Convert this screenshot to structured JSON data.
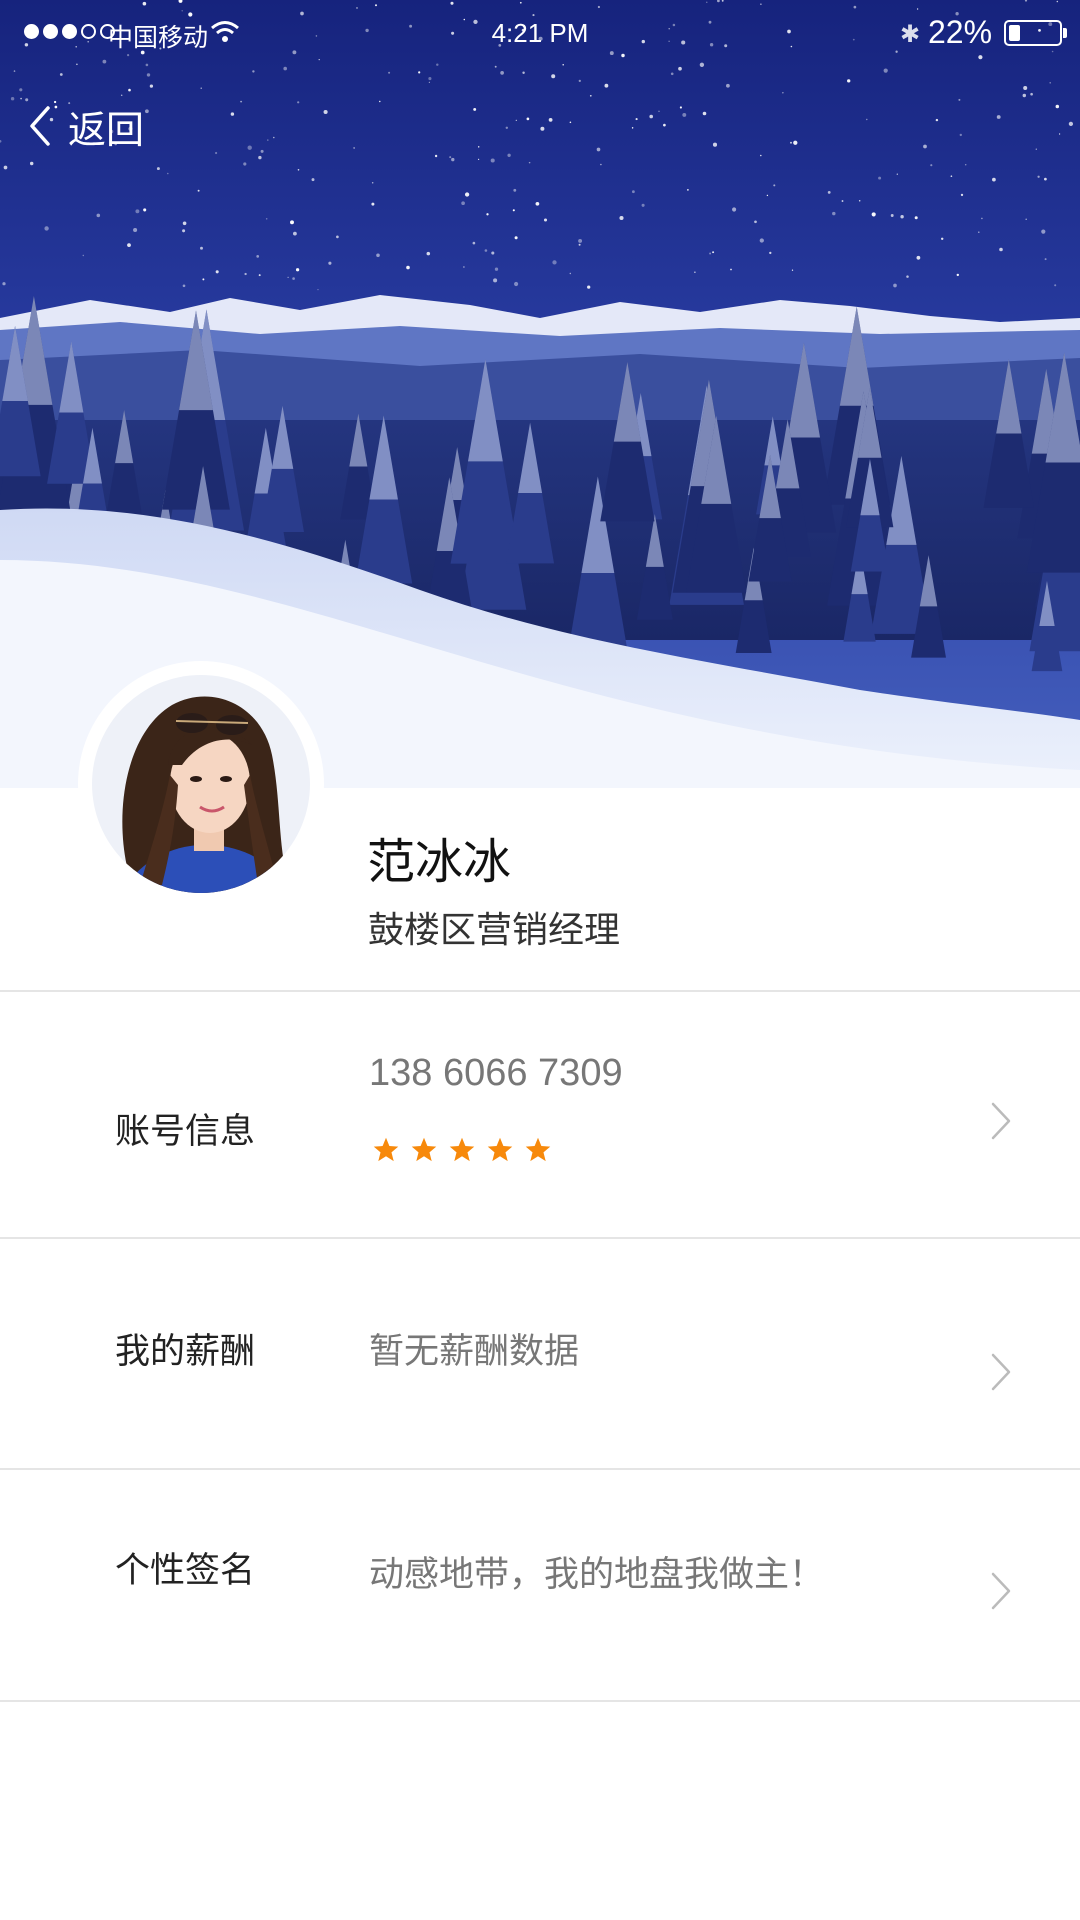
{
  "status_bar": {
    "carrier": "中国移动",
    "time": "4:21 PM",
    "battery_percent": "22%",
    "battery_level": 0.22,
    "signal_bars_filled": 3,
    "signal_bars_total": 5
  },
  "nav": {
    "back_label": "返回"
  },
  "profile": {
    "name": "范冰冰",
    "title": "鼓楼区营销经理"
  },
  "rows": [
    {
      "label": "账号信息",
      "value": "138 6066 7309",
      "rating": 5,
      "rating_max": 5
    },
    {
      "label": "我的薪酬",
      "value": "暂无薪酬数据"
    },
    {
      "label": "个性签名",
      "value": "动感地带，我的地盘我做主！"
    }
  ],
  "colors": {
    "accent_star": "#f7890b",
    "chevron": "#bbbbbb",
    "divider": "#e5e5e5"
  },
  "icons": [
    "back-chevron-icon",
    "wifi-icon",
    "bluetooth-icon",
    "battery-icon",
    "star-icon",
    "chevron-right-icon"
  ]
}
